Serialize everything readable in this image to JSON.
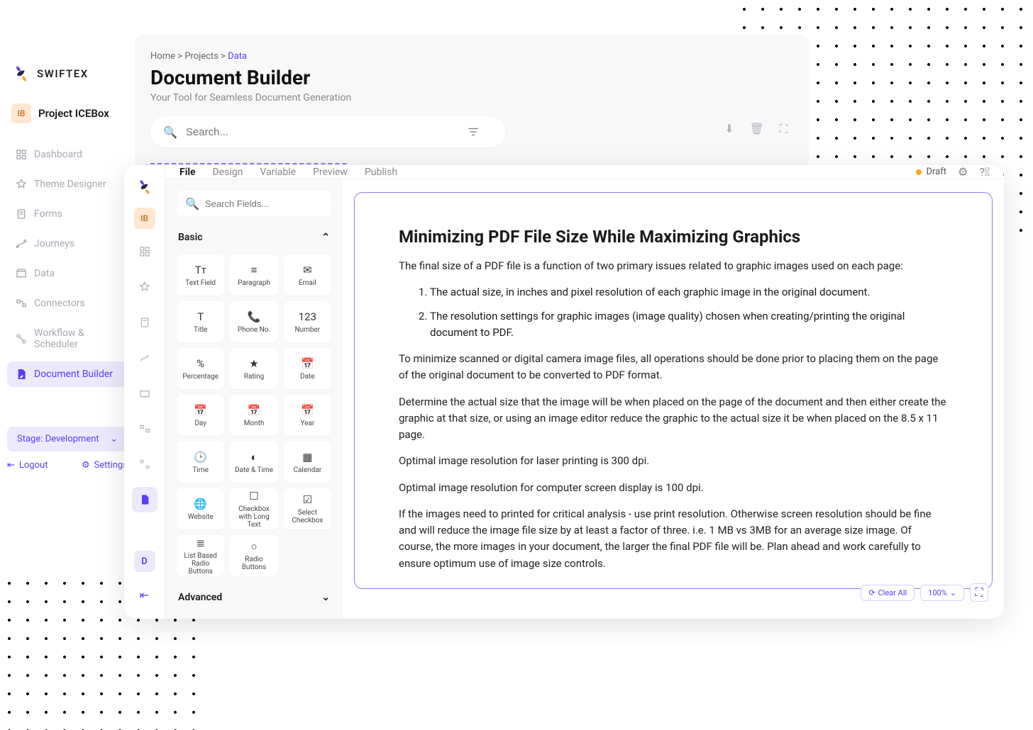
{
  "brand": {
    "name": "SWIFTEX"
  },
  "project": {
    "initials": "IB",
    "name": "Project ICEBox"
  },
  "sidebar": {
    "items": [
      {
        "key": "dashboard",
        "label": "Dashboard"
      },
      {
        "key": "theme-designer",
        "label": "Theme Designer"
      },
      {
        "key": "forms",
        "label": "Forms"
      },
      {
        "key": "journeys",
        "label": "Journeys"
      },
      {
        "key": "data",
        "label": "Data"
      },
      {
        "key": "connectors",
        "label": "Connectors"
      },
      {
        "key": "workflow",
        "label": "Workflow & Scheduler"
      },
      {
        "key": "doc-builder",
        "label": "Document Builder"
      }
    ],
    "stage": "Stage: Development",
    "logout": "Logout",
    "settings": "Settings"
  },
  "breadcrumb": {
    "home": "Home",
    "mid": "Projects",
    "current": "Data"
  },
  "page": {
    "title": "Document Builder",
    "subtitle": "Your Tool for Seamless Document Generation"
  },
  "search": {
    "placeholder": "Search..."
  },
  "editor": {
    "mini_avatar": "IB",
    "mini_letter": "D",
    "tabs": [
      "File",
      "Design",
      "Variable",
      "Preview",
      "Publish"
    ],
    "status": "Draft",
    "fields_search_placeholder": "Search Fields...",
    "sections": {
      "basic": "Basic",
      "advanced": "Advanced"
    },
    "fields": [
      {
        "icon": "Tᴛ",
        "label": "Text Field"
      },
      {
        "icon": "≡",
        "label": "Paragraph"
      },
      {
        "icon": "✉",
        "label": "Email"
      },
      {
        "icon": "T",
        "label": "Title"
      },
      {
        "icon": "📞",
        "label": "Phone No."
      },
      {
        "icon": "123",
        "label": "Number"
      },
      {
        "icon": "%",
        "label": "Percentage"
      },
      {
        "icon": "★",
        "label": "Rating"
      },
      {
        "icon": "📅",
        "label": "Date"
      },
      {
        "icon": "📅",
        "label": "Day"
      },
      {
        "icon": "📅",
        "label": "Month"
      },
      {
        "icon": "📅",
        "label": "Year"
      },
      {
        "icon": "🕒",
        "label": "Time"
      },
      {
        "icon": "◐",
        "label": "Date & Time"
      },
      {
        "icon": "▦",
        "label": "Calendar"
      },
      {
        "icon": "🌐",
        "label": "Website"
      },
      {
        "icon": "☐",
        "label": "Checkbox with Long Text"
      },
      {
        "icon": "☑",
        "label": "Select Checkbox"
      },
      {
        "icon": "≣",
        "label": "List Based Radio Buttons"
      },
      {
        "icon": "○",
        "label": "Radio Buttons"
      }
    ],
    "document": {
      "title": "Minimizing PDF File Size While Maximizing Graphics",
      "intro": "The final size of a PDF file is a function of two primary issues related to graphic images used on each page:",
      "li1": "The actual size, in inches and pixel resolution of each graphic image in the original document.",
      "li2": "The resolution settings for graphic images (image quality) chosen when creating/printing the original document to PDF.",
      "p2": "To minimize scanned or digital camera image files, all operations should be done prior to placing them on the page of the original document to be converted to PDF format.",
      "p3": "Determine the actual size that the image will be when placed on the page of the document and then either create the graphic at that size, or using an image editor reduce the graphic to the actual size it be when placed on the 8.5 x 11 page.",
      "p4": "Optimal image resolution for laser printing is 300 dpi.",
      "p5": "Optimal image resolution for computer screen display is 100 dpi.",
      "p6": "If the images need to printed for critical analysis - use print resolution. Otherwise screen resolution should be fine and will reduce the image file size by at least a factor of three. i.e. 1 MB vs 3MB for an average size image. Of course, the more images in your document, the larger the final PDF file will be. Plan ahead and work carefully to ensure optimum use of image size controls."
    },
    "tools": {
      "clear": "Clear All",
      "zoom": "100%"
    }
  }
}
